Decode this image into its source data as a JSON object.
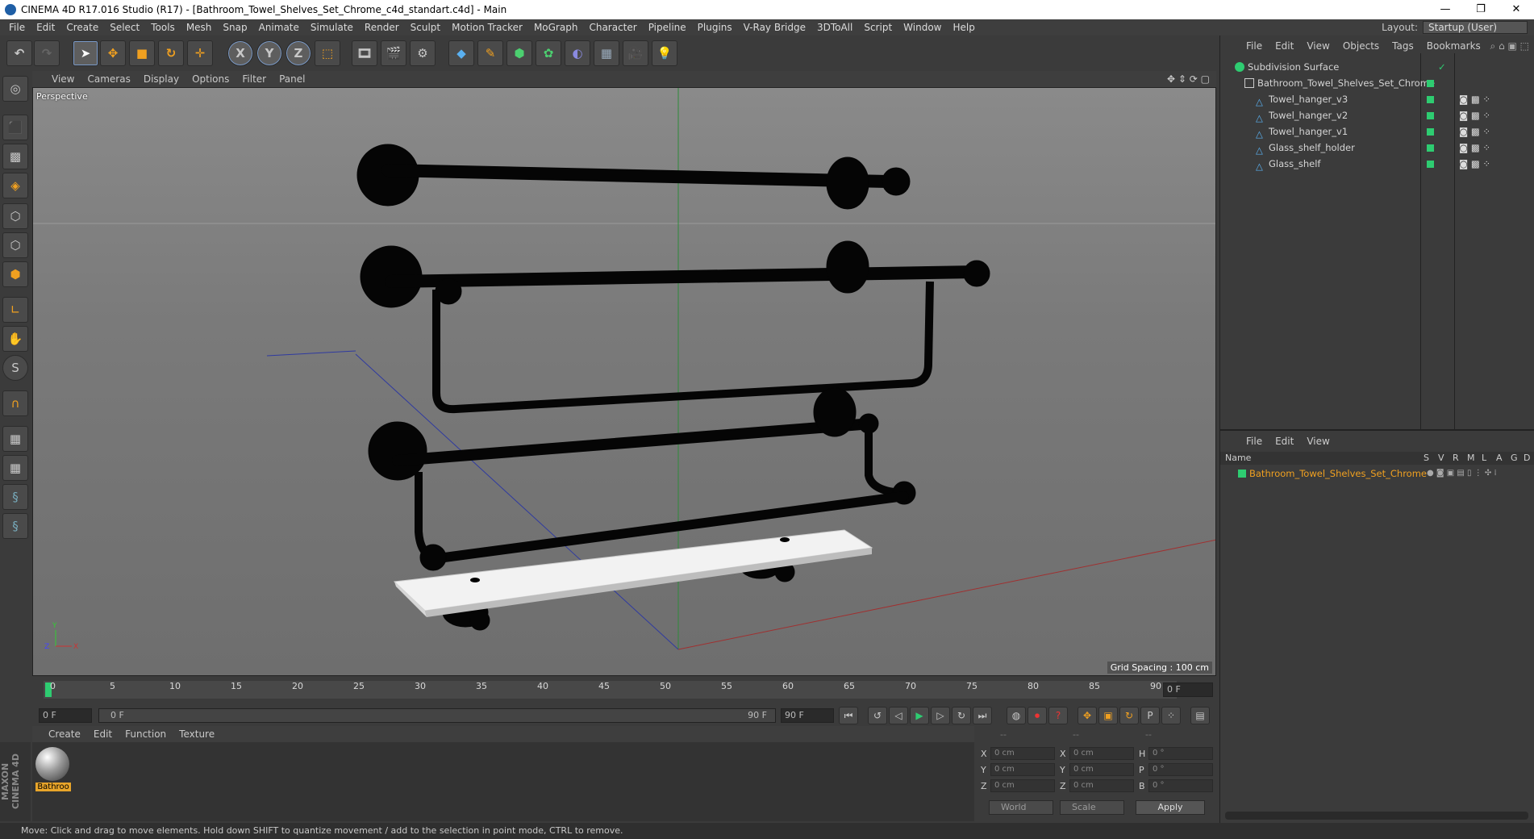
{
  "window": {
    "title": "CINEMA 4D R17.016 Studio (R17) - [Bathroom_Towel_Shelves_Set_Chrome_c4d_standart.c4d] - Main",
    "minimize": "—",
    "maximize": "❐",
    "close": "✕"
  },
  "menu": [
    "File",
    "Edit",
    "Create",
    "Select",
    "Tools",
    "Mesh",
    "Snap",
    "Animate",
    "Simulate",
    "Render",
    "Sculpt",
    "Motion Tracker",
    "MoGraph",
    "Character",
    "Pipeline",
    "Plugins",
    "V-Ray Bridge",
    "3DToAll",
    "Script",
    "Window",
    "Help"
  ],
  "layout": {
    "label": "Layout:",
    "value": "Startup (User)"
  },
  "viewport": {
    "menu": [
      "View",
      "Cameras",
      "Display",
      "Options",
      "Filter",
      "Panel"
    ],
    "name": "Perspective",
    "grid_spacing": "Grid Spacing : 100 cm"
  },
  "timeline": {
    "ticks": [
      "0",
      "5",
      "10",
      "15",
      "20",
      "25",
      "30",
      "35",
      "40",
      "45",
      "50",
      "55",
      "60",
      "65",
      "70",
      "75",
      "80",
      "85",
      "90"
    ],
    "current_frame": "0 F",
    "start": "0 F",
    "range_start": "0 F",
    "range_end": "90 F",
    "end": "90 F"
  },
  "material_panel": {
    "menu": [
      "Create",
      "Edit",
      "Function",
      "Texture"
    ],
    "material_label": "Bathroo"
  },
  "coordinates": {
    "col_headers": [
      "--",
      "--",
      "--"
    ],
    "rows": [
      {
        "a": "X",
        "av": "0 cm",
        "b": "X",
        "bv": "0 cm",
        "c": "H",
        "cv": "0 °"
      },
      {
        "a": "Y",
        "av": "0 cm",
        "b": "Y",
        "bv": "0 cm",
        "c": "P",
        "cv": "0 °"
      },
      {
        "a": "Z",
        "av": "0 cm",
        "b": "Z",
        "bv": "0 cm",
        "c": "B",
        "cv": "0 °"
      }
    ],
    "space": "World",
    "mode": "Scale",
    "apply": "Apply"
  },
  "objects_panel": {
    "menu": [
      "File",
      "Edit",
      "View",
      "Objects",
      "Tags",
      "Bookmarks"
    ],
    "items": [
      {
        "name": "Subdivision Surface"
      },
      {
        "name": "Bathroom_Towel_Shelves_Set_Chrome"
      },
      {
        "name": "Towel_hanger_v3"
      },
      {
        "name": "Towel_hanger_v2"
      },
      {
        "name": "Towel_hanger_v1"
      },
      {
        "name": "Glass_shelf_holder"
      },
      {
        "name": "Glass_shelf"
      }
    ]
  },
  "attributes_panel": {
    "menu": [
      "File",
      "Edit",
      "View"
    ],
    "columns": {
      "name": "Name",
      "flags": [
        "S",
        "V",
        "R",
        "M",
        "L",
        "A",
        "G",
        "D"
      ]
    },
    "item": "Bathroom_Towel_Shelves_Set_Chrome"
  },
  "status": "Move: Click and drag to move elements. Hold down SHIFT to quantize movement / add to the selection in point mode, CTRL to remove.",
  "brand": "MAXON CINEMA 4D"
}
